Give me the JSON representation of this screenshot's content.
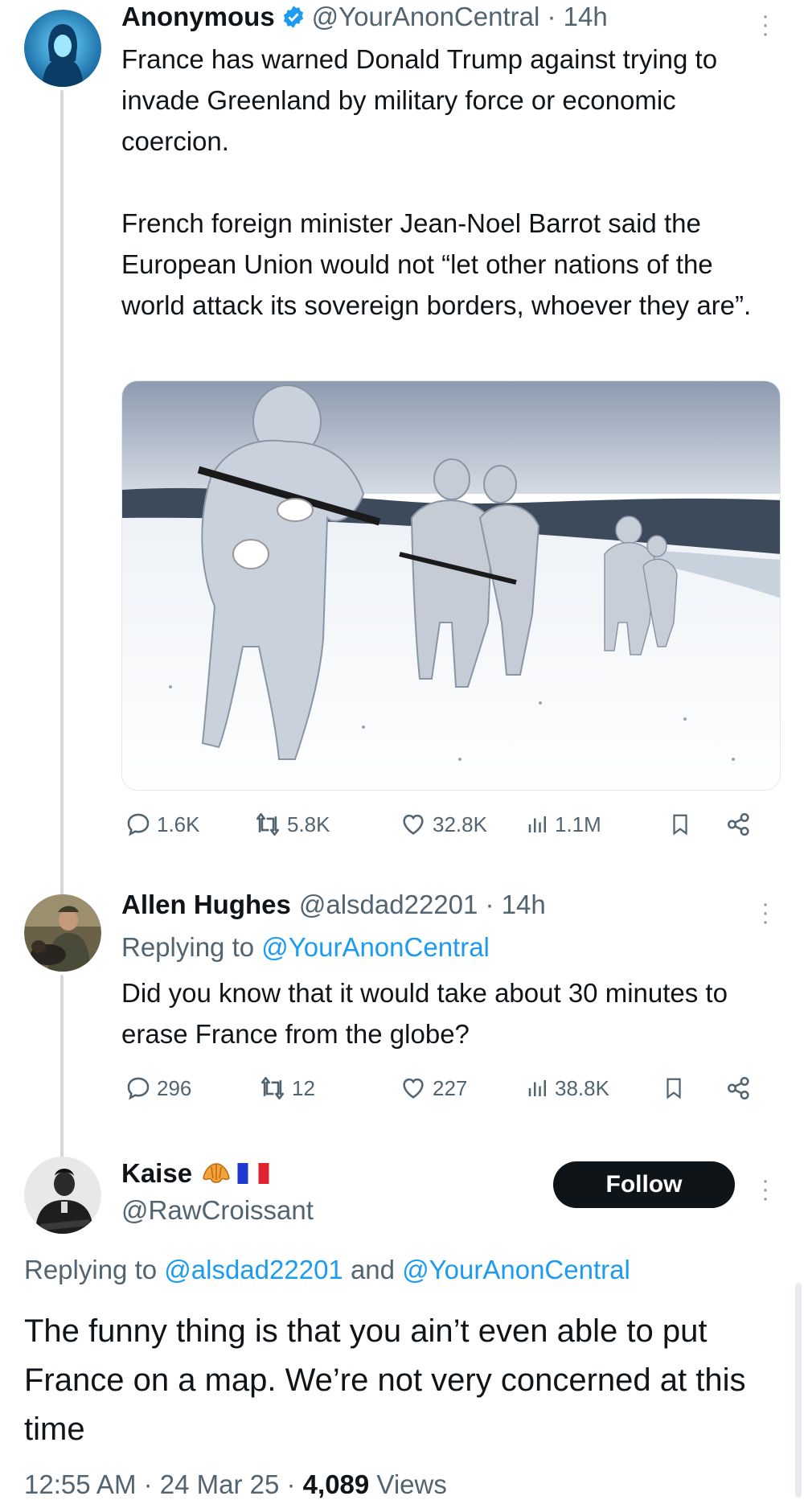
{
  "tweet": {
    "author_name": "Anonymous",
    "handle_time": "@YourAnonCentral · 14h",
    "text": "France has warned Donald Trump against trying to invade Greenland by military force or economic coercion.\n\nFrench foreign minister Jean-Noel Barrot said the European Union would not “let other nations of the world attack its sovereign borders, whoever they are”.",
    "image_icon": "soldiers-in-snow-photo",
    "stats": {
      "replies": "1.6K",
      "retweets": "5.8K",
      "likes": "32.8K",
      "views": "1.1M"
    }
  },
  "reply1": {
    "author_name": "Allen Hughes",
    "handle_time": "@alsdad22201 · 14h",
    "replying_prefix": "Replying to ",
    "replying_mention": "@YourAnonCentral",
    "text": "Did you know that it would take about 30 minutes to erase France from the globe?",
    "stats": {
      "replies": "296",
      "retweets": "12",
      "likes": "227",
      "views": "38.8K"
    }
  },
  "reply2": {
    "author_name": "Kaise",
    "name_emoji_icons": [
      "croissant-icon",
      "france-flag-icon"
    ],
    "handle": "@RawCroissant",
    "follow_label": "Follow",
    "replying_prefix": "Replying to ",
    "replying_mention_1": "@alsdad22201",
    "replying_and": " and ",
    "replying_mention_2": "@YourAnonCentral",
    "text": "The funny thing is that you ain’t even able to put France on a map. We’re not very concerned at this time",
    "time_date": "12:55 AM · 24 Mar 25 · ",
    "views_count": "4,089",
    "views_label": " Views"
  },
  "colors": {
    "text": "#0f1419",
    "secondary": "#536471",
    "link": "#1d9bf0",
    "verified": "#1d9bf0",
    "thread_line": "#cfd9de"
  }
}
